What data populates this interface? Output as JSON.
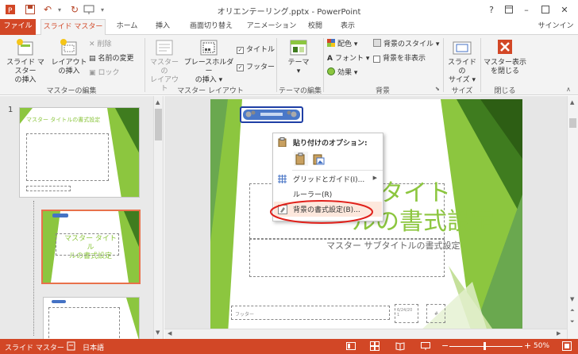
{
  "window": {
    "title": "オリエンテーリング.pptx - PowerPoint",
    "help": "?",
    "minimize": "–",
    "close": "✕"
  },
  "tabs": [
    {
      "label": "ファイル"
    },
    {
      "label": "スライド マスター"
    },
    {
      "label": "ホーム"
    },
    {
      "label": "挿入"
    },
    {
      "label": "画面切り替え"
    },
    {
      "label": "アニメーション"
    },
    {
      "label": "校閲"
    },
    {
      "label": "表示"
    }
  ],
  "signin": "サインイン",
  "ribbon": {
    "groups": {
      "master_edit": "マスターの編集",
      "master_layout": "マスター レイアウト",
      "theme_edit": "テーマの編集",
      "background": "背景",
      "size": "サイズ",
      "close": "閉じる"
    },
    "insert_slide_master": "スライド マスター\nの挿入",
    "insert_layout": "レイアウト\nの挿入",
    "delete": "削除",
    "rename": "名前の変更",
    "lock": "ロック",
    "master_layout_btn": "マスターの\nレイアウト",
    "insert_placeholder": "プレースホルダー\nの挿入 ▾",
    "title_check": "タイトル",
    "footer_check": "フッター",
    "theme": "テーマ\n▾",
    "colors": "配色 ▾",
    "fonts": "フォント ▾",
    "effects": "効果 ▾",
    "bg_style": "背景のスタイル ▾",
    "hide_bg": "背景を非表示",
    "slide_size": "スライドの\nサイズ ▾",
    "close_master": "マスター表示\nを閉じる"
  },
  "thumbs": {
    "slide_number": "1",
    "master_title": "マスター タイトルの書式設定",
    "layout_title": "マスター タイトル\nルの書式設定"
  },
  "slide": {
    "title_tail": "タイト",
    "title_line2": "ルの書式設定",
    "subtitle": "マスター サブタイトルの書式設定",
    "footer": "フッター",
    "date": "6/24/20\n1",
    "page": "#"
  },
  "context_menu": {
    "paste_options": "貼り付けのオプション:",
    "grid_guides": "グリッドとガイド(I)...",
    "ruler": "ルーラー(R)",
    "format_background": "背景の書式設定(B)..."
  },
  "status": {
    "view": "スライド マスター",
    "language": "日本語",
    "zoom": "50%"
  },
  "colors": {
    "accent": "#d24726",
    "green": "#8cc63f",
    "dark_green": "#3f7c1f"
  }
}
